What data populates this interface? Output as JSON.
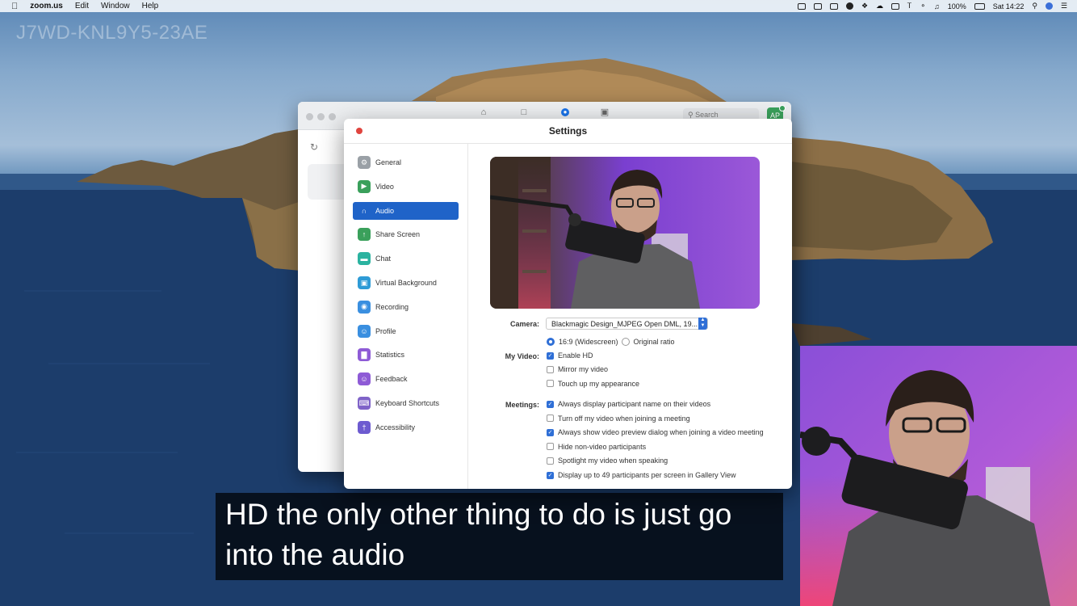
{
  "watermark": "J7WD-KNL9Y5-23AE",
  "menubar": {
    "apple": "",
    "app_name": "zoom.us",
    "menus": [
      "Edit",
      "Window",
      "Help"
    ],
    "battery": "100%",
    "clock": "Sat 14:22"
  },
  "zoom_main": {
    "search_placeholder": "Search",
    "avatar_initials": "AP"
  },
  "settings": {
    "title": "Settings",
    "sidebar": [
      {
        "label": "General",
        "icon": "gear-icon",
        "color": "#9aa0a6"
      },
      {
        "label": "Video",
        "icon": "video-icon",
        "color": "#3aa05b"
      },
      {
        "label": "Audio",
        "icon": "headphones-icon",
        "color": "#1f63c8"
      },
      {
        "label": "Share Screen",
        "icon": "share-screen-icon",
        "color": "#3aa05b"
      },
      {
        "label": "Chat",
        "icon": "chat-icon",
        "color": "#2bb3a0"
      },
      {
        "label": "Virtual Background",
        "icon": "virtual-background-icon",
        "color": "#2e9bd6"
      },
      {
        "label": "Recording",
        "icon": "recording-icon",
        "color": "#3a8fe0"
      },
      {
        "label": "Profile",
        "icon": "profile-icon",
        "color": "#3a8fe0"
      },
      {
        "label": "Statistics",
        "icon": "statistics-icon",
        "color": "#8e5bd6"
      },
      {
        "label": "Feedback",
        "icon": "feedback-icon",
        "color": "#8e5bd6"
      },
      {
        "label": "Keyboard Shortcuts",
        "icon": "keyboard-icon",
        "color": "#7f63c8"
      },
      {
        "label": "Accessibility",
        "icon": "accessibility-icon",
        "color": "#6d5bd0"
      }
    ],
    "active_item": "Audio",
    "camera_label": "Camera:",
    "camera_value": "Blackmagic Design_MJPEG Open DML, 19...",
    "my_video_label": "My Video:",
    "aspect_widescreen": "16:9 (Widescreen)",
    "aspect_original": "Original ratio",
    "my_video_options": [
      {
        "label": "Enable HD",
        "checked": true
      },
      {
        "label": "Mirror my video",
        "checked": false
      },
      {
        "label": "Touch up my appearance",
        "checked": false
      }
    ],
    "meetings_label": "Meetings:",
    "meetings_options": [
      {
        "label": "Always display participant name on their videos",
        "checked": true
      },
      {
        "label": "Turn off my video when joining a meeting",
        "checked": false
      },
      {
        "label": "Always show video preview dialog when joining a video meeting",
        "checked": true
      },
      {
        "label": "Hide non-video participants",
        "checked": false
      },
      {
        "label": "Spotlight my video when speaking",
        "checked": false
      },
      {
        "label": "Display up to 49 participants per screen in Gallery View",
        "checked": true
      }
    ]
  },
  "subtitle": {
    "line1": "HD the only other thing to do is just go",
    "line2": "into the audio"
  }
}
